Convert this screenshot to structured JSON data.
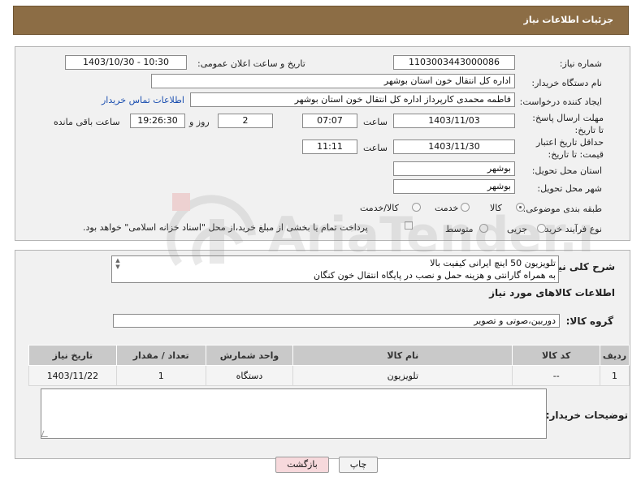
{
  "header": {
    "title": "جزئیات اطلاعات نیاز"
  },
  "fields": {
    "need_number_label": "شماره نیاز:",
    "need_number": "1103003443000086",
    "announce_label": "تاریخ و ساعت اعلان عمومی:",
    "announce_value": "1403/10/30 - 10:30",
    "buyer_org_label": "نام دستگاه خریدار:",
    "buyer_org": "اداره کل انتقال خون استان بوشهر",
    "creator_label": "ایجاد کننده درخواست:",
    "creator": "فاطمه محمدی کارپرداز اداره کل انتقال خون استان بوشهر",
    "contact_link": "اطلاعات تماس خریدار",
    "reply_deadline_label": "مهلت ارسال پاسخ: تا تاریخ:",
    "reply_date": "1403/11/03",
    "time_label": "ساعت",
    "reply_time": "07:07",
    "days_value": "2",
    "days_label": "روز و",
    "remaining_time": "19:26:30",
    "remaining_label": "ساعت باقی مانده",
    "price_validity_label": "حداقل تاریخ اعتبار قیمت: تا تاریخ:",
    "price_date": "1403/11/30",
    "price_time": "11:11",
    "province_label": "استان محل تحویل:",
    "province": "بوشهر",
    "city_label": "شهر محل تحویل:",
    "city": "بوشهر",
    "category_label": "طبقه بندی موضوعی:",
    "category_options": [
      "کالا",
      "خدمت",
      "کالا/خدمت"
    ],
    "category_selected": "کالا",
    "purchase_type_label": "نوع فرآیند خرید :",
    "purchase_options": [
      "جزیی",
      "متوسط"
    ],
    "payment_note": "پرداخت تمام یا بخشی از مبلغ خرید،از محل \"اسناد خزانه اسلامی\" خواهد بود."
  },
  "description": {
    "label": "شرح کلی نیاز:",
    "line1": "تلویزیون 50 اینچ ایرانی کیفیت بالا",
    "line2": "به همراه گارانتی و هزینه حمل و نصب در پایگاه انتقال خون کنگان"
  },
  "goods": {
    "section_title": "اطلاعات کالاهای مورد نیاز",
    "group_label": "گروه کالا:",
    "group_value": "دوربین،صوتی و تصویر",
    "columns": [
      "ردیف",
      "کد کالا",
      "نام کالا",
      "واحد شمارش",
      "تعداد / مقدار",
      "تاریخ نیاز"
    ],
    "rows": [
      [
        "1",
        "--",
        "تلویزیون",
        "دستگاه",
        "1",
        "1403/11/22"
      ]
    ]
  },
  "buyer_notes": {
    "label": "توضیحات خریدار:",
    "value": ""
  },
  "buttons": {
    "print": "چاپ",
    "back": "بازگشت"
  },
  "colors": {
    "header_bg": "#8c6d45",
    "panel_bg": "#f1f1f1",
    "back_button_bg": "#f7d9dc"
  },
  "watermark": {
    "text": "AriaTender.neT"
  }
}
